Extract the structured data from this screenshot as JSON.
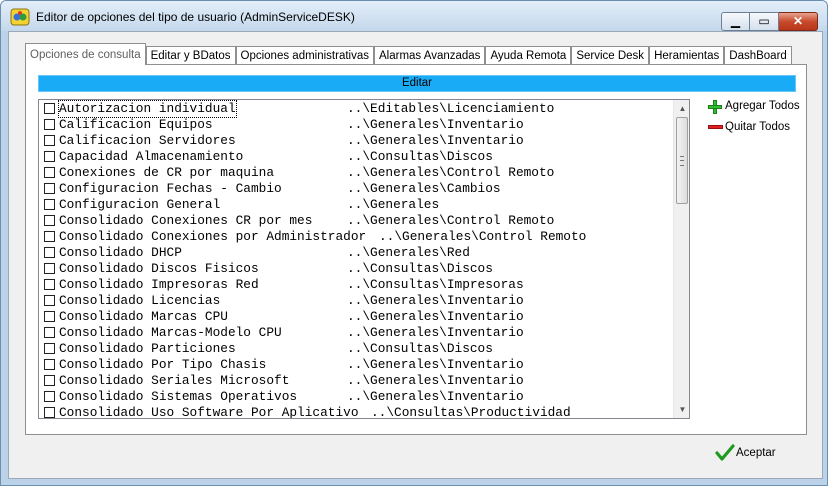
{
  "window": {
    "title": "Editor de opciones del tipo de usuario (AdminServiceDESK)",
    "controls": {
      "minimize": "minimize-icon",
      "maximize": "maximize-icon",
      "close": "close-icon"
    }
  },
  "tabs": [
    {
      "label": "Opciones de consulta",
      "active": true
    },
    {
      "label": "Editar y BDatos"
    },
    {
      "label": "Opciones administrativas"
    },
    {
      "label": "Alarmas Avanzadas"
    },
    {
      "label": "Ayuda Remota"
    },
    {
      "label": "Service Desk"
    },
    {
      "label": "Heramientas"
    },
    {
      "label": "DashBoard"
    }
  ],
  "panel": {
    "header": "Editar",
    "items": [
      {
        "name": "Autorizacion individual",
        "path": "..\\Editables\\Licenciamiento",
        "checked": false
      },
      {
        "name": "Calificacion Equipos",
        "path": "..\\Generales\\Inventario",
        "checked": false
      },
      {
        "name": "Calificacion Servidores",
        "path": "..\\Generales\\Inventario",
        "checked": false
      },
      {
        "name": "Capacidad Almacenamiento",
        "path": "..\\Consultas\\Discos",
        "checked": false
      },
      {
        "name": "Conexiones de CR por maquina",
        "path": "..\\Generales\\Control Remoto",
        "checked": false
      },
      {
        "name": "Configuracion Fechas - Cambio",
        "path": "..\\Generales\\Cambios",
        "checked": false
      },
      {
        "name": "Configuracion General",
        "path": "..\\Generales",
        "checked": false
      },
      {
        "name": "Consolidado Conexiones CR por mes",
        "path": "..\\Generales\\Control Remoto",
        "checked": false
      },
      {
        "name": "Consolidado Conexiones por Administrador",
        "path": "..\\Generales\\Control Remoto",
        "checked": false
      },
      {
        "name": "Consolidado DHCP",
        "path": "..\\Generales\\Red",
        "checked": false
      },
      {
        "name": "Consolidado Discos Fisicos",
        "path": "..\\Consultas\\Discos",
        "checked": false
      },
      {
        "name": "Consolidado Impresoras Red",
        "path": "..\\Consultas\\Impresoras",
        "checked": false
      },
      {
        "name": "Consolidado Licencias",
        "path": "..\\Generales\\Inventario",
        "checked": false
      },
      {
        "name": "Consolidado Marcas CPU",
        "path": "..\\Generales\\Inventario",
        "checked": false
      },
      {
        "name": "Consolidado Marcas-Modelo CPU",
        "path": "..\\Generales\\Inventario",
        "checked": false
      },
      {
        "name": "Consolidado Particiones",
        "path": "..\\Consultas\\Discos",
        "checked": false
      },
      {
        "name": "Consolidado Por Tipo Chasis",
        "path": "..\\Generales\\Inventario",
        "checked": false
      },
      {
        "name": "Consolidado Seriales Microsoft",
        "path": "..\\Generales\\Inventario",
        "checked": false
      },
      {
        "name": "Consolidado Sistemas Operativos",
        "path": "..\\Generales\\Inventario",
        "checked": false
      },
      {
        "name": "Consolidado Uso Software Por Aplicativo",
        "path": "..\\Consultas\\Productividad",
        "checked": false
      }
    ],
    "add_all": "Agregar Todos",
    "remove_all": "Quitar Todos"
  },
  "footer": {
    "accept": "Aceptar"
  },
  "colors": {
    "header_bar": "#1aabf6",
    "add": "#2fbf2f",
    "remove": "#e02020",
    "accept_check": "#1f9a1f"
  }
}
